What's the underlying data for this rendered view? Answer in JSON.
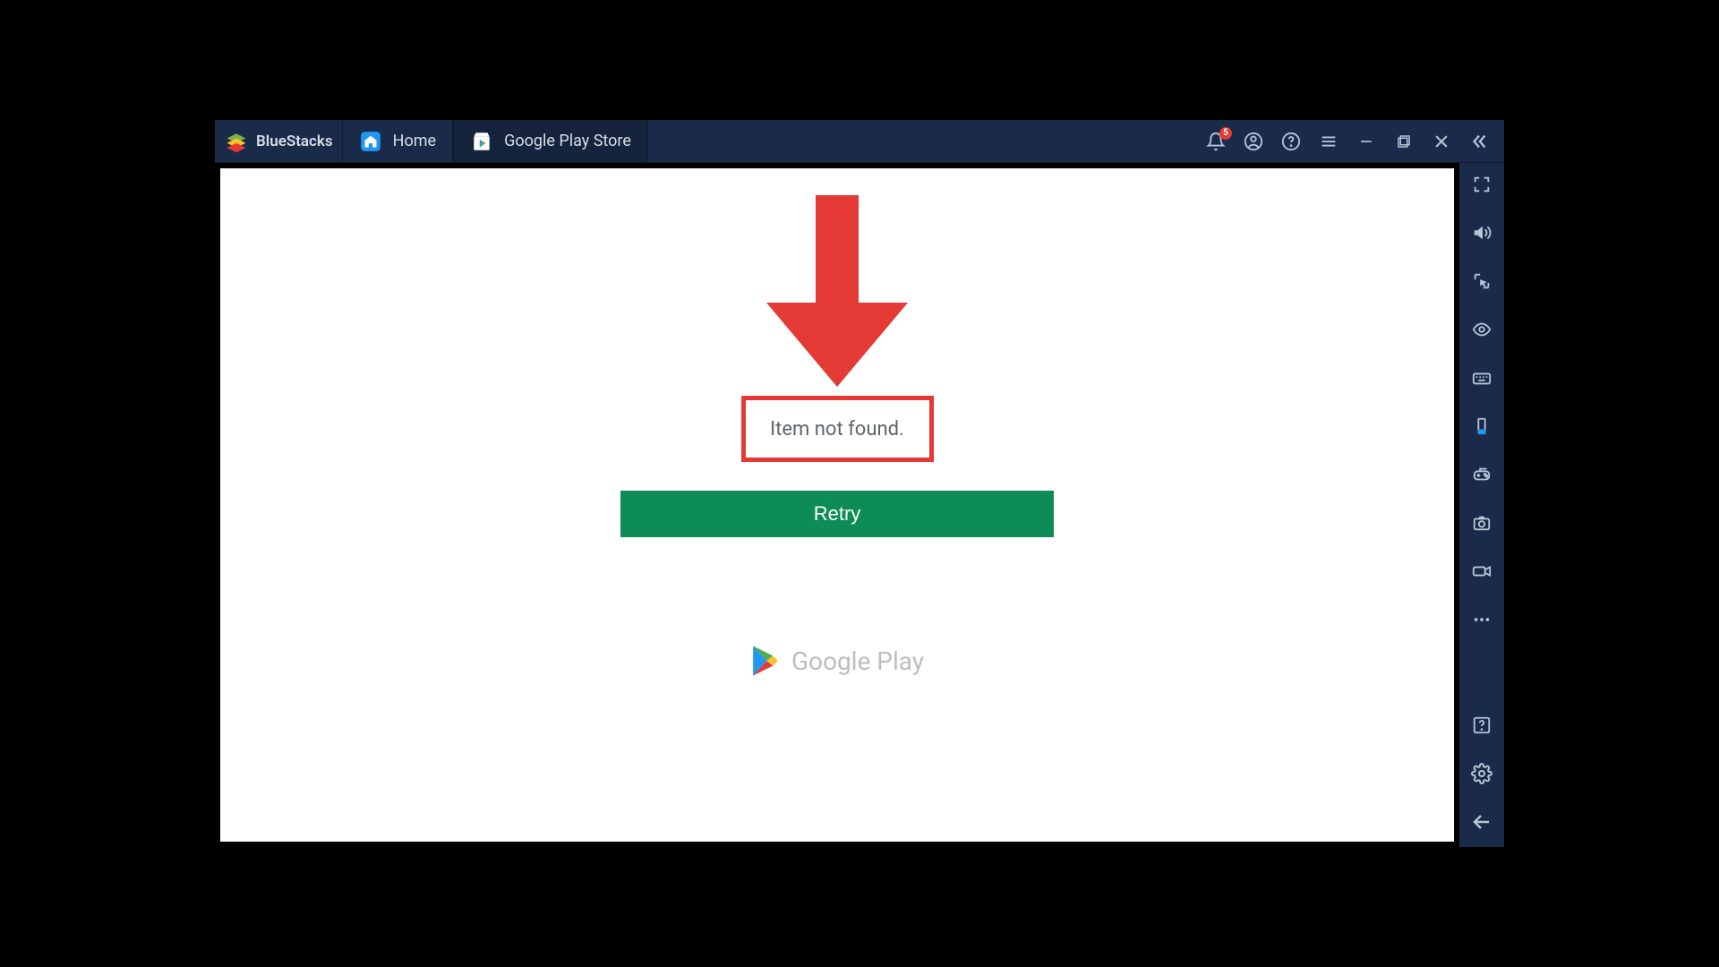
{
  "app": {
    "name": "BlueStacks"
  },
  "tabs": [
    {
      "label": "Home",
      "icon": "home-icon"
    },
    {
      "label": "Google Play Store",
      "icon": "play-store-icon"
    }
  ],
  "titlebar": {
    "notification_badge": "5",
    "icons": [
      "bell-icon",
      "account-icon",
      "help-icon",
      "menu-icon",
      "minimize-icon",
      "maximize-icon",
      "close-icon",
      "collapse-sidebar-icon"
    ]
  },
  "content": {
    "error_message": "Item not found.",
    "retry_label": "Retry",
    "play_brand": "Google Play"
  },
  "sidebar": {
    "top_icons": [
      "fullscreen-icon",
      "volume-icon",
      "screen-cursor-icon",
      "eye-icon",
      "keyboard-icon",
      "rotate-device-icon",
      "gamepad-icon",
      "camera-icon",
      "record-icon",
      "more-icon"
    ],
    "bottom_icons": [
      "help-box-icon",
      "settings-icon",
      "back-icon"
    ]
  },
  "colors": {
    "chrome": "#1a2b4a",
    "accent_red": "#e53935",
    "retry_green": "#0d8c56",
    "muted_text": "#b8c3d8"
  }
}
